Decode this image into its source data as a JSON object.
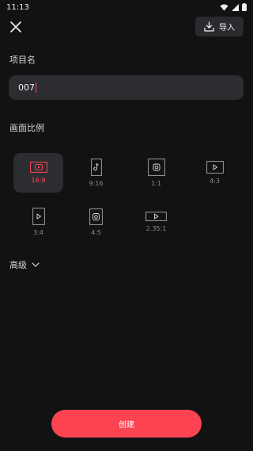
{
  "status_bar": {
    "time": "11:13"
  },
  "top_bar": {
    "import_label": "导入"
  },
  "project_name": {
    "label": "项目名",
    "value": "007"
  },
  "aspect_ratio": {
    "label": "画面比例",
    "options": [
      {
        "label": "16:9",
        "icon": "youtube-icon",
        "selected": true
      },
      {
        "label": "9:16",
        "icon": "tiktok-icon",
        "selected": false
      },
      {
        "label": "1:1",
        "icon": "instagram-icon",
        "selected": false
      },
      {
        "label": "4:3",
        "icon": "play-icon",
        "selected": false
      },
      {
        "label": "3:4",
        "icon": "play-icon",
        "selected": false
      },
      {
        "label": "4:5",
        "icon": "instagram-icon",
        "selected": false
      },
      {
        "label": "2.35:1",
        "icon": "play-icon",
        "selected": false
      }
    ]
  },
  "advanced": {
    "label": "高级"
  },
  "create_button": {
    "label": "创建"
  },
  "colors": {
    "accent": "#fb4352",
    "background": "#121212",
    "surface": "#2b2d31"
  }
}
